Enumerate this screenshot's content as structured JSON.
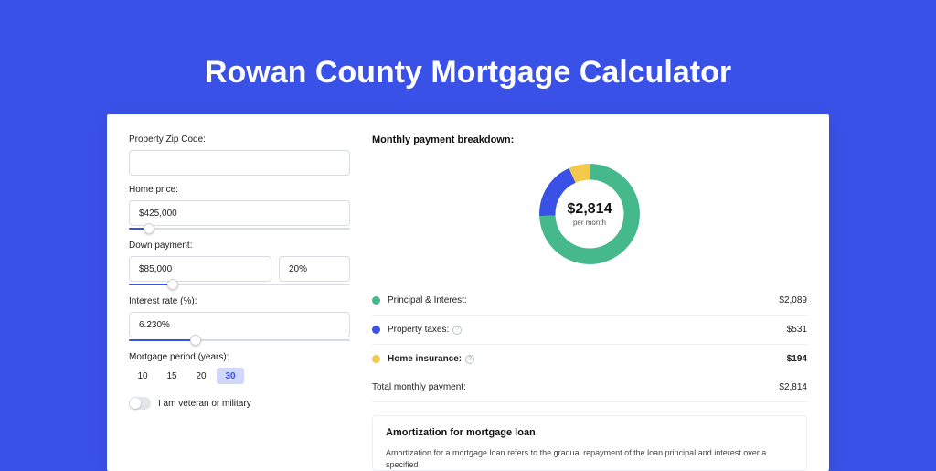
{
  "header": {
    "title": "Rowan County Mortgage Calculator"
  },
  "form": {
    "zip": {
      "label": "Property Zip Code:",
      "value": ""
    },
    "home_price": {
      "label": "Home price:",
      "value": "$425,000",
      "slider_pct": 9
    },
    "down_payment": {
      "label": "Down payment:",
      "amount": "$85,000",
      "percent": "20%",
      "slider_pct": 20
    },
    "interest": {
      "label": "Interest rate (%):",
      "value": "6.230%",
      "slider_pct": 30
    },
    "period": {
      "label": "Mortgage period (years):",
      "options": [
        "10",
        "15",
        "20",
        "30"
      ],
      "selected": "30"
    },
    "veteran": {
      "label": "I am veteran or military"
    }
  },
  "breakdown": {
    "title": "Monthly payment breakdown:",
    "center_amount": "$2,814",
    "center_sub": "per month",
    "rows": [
      {
        "dot": "#46b98c",
        "label": "Principal & Interest:",
        "has_info": false,
        "value": "$2,089"
      },
      {
        "dot": "#3a51e8",
        "label": "Property taxes:",
        "has_info": true,
        "value": "$531"
      },
      {
        "dot": "#f2c94c",
        "label": "Home insurance:",
        "has_info": true,
        "value": "$194"
      }
    ],
    "total": {
      "label": "Total monthly payment:",
      "value": "$2,814"
    }
  },
  "amortization": {
    "title": "Amortization for mortgage loan",
    "body": "Amortization for a mortgage loan refers to the gradual repayment of the loan principal and interest over a specified"
  },
  "chart_data": {
    "type": "pie",
    "title": "Monthly payment breakdown",
    "series": [
      {
        "name": "Principal & Interest",
        "value": 2089,
        "color": "#46b98c"
      },
      {
        "name": "Property taxes",
        "value": 531,
        "color": "#3a51e8"
      },
      {
        "name": "Home insurance",
        "value": 194,
        "color": "#f2c94c"
      }
    ],
    "total": 2814,
    "center_label": "$2,814 per month"
  }
}
